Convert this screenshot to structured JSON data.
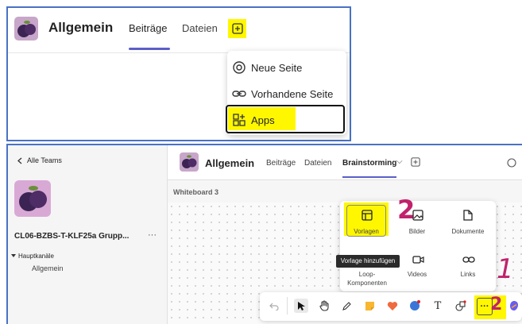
{
  "top": {
    "channel_title": "Allgemein",
    "tabs": [
      "Beiträge",
      "Dateien"
    ],
    "add_menu": {
      "items": [
        {
          "label": "Neue Seite",
          "icon": "loop-page-icon"
        },
        {
          "label": "Vorhandene Seite",
          "icon": "link-icon"
        },
        {
          "label": "Apps",
          "icon": "apps-icon"
        }
      ]
    }
  },
  "bottom": {
    "sidebar": {
      "back_label": "Alle Teams",
      "team_name": "CL06-BZBS-T-KLF25a Grupp...",
      "more": "···",
      "section_label": "Hauptkanäle",
      "channel": "Allgemein"
    },
    "header": {
      "channel_title": "Allgemein",
      "tabs": [
        "Beiträge",
        "Dateien",
        "Brainstorming"
      ],
      "active_tab_chevron": "⌵"
    },
    "whiteboard_label": "Whiteboard 3",
    "palette": {
      "row1": [
        "Vorlagen",
        "Bilder",
        "Dokumente"
      ],
      "row2": [
        "Loop-Komponenten",
        "Videos",
        "Links"
      ],
      "tooltip": "Vorlage hinzufügen"
    },
    "toolbar": {
      "text_tool": "T",
      "more_label": "···"
    },
    "annotations": {
      "num1": "2",
      "num2": "2",
      "num3": "1"
    }
  },
  "colors": {
    "accent": "#5b5fc7",
    "highlight": "#fff700",
    "annotation": "#c0226b",
    "frame": "#4a72c4"
  }
}
